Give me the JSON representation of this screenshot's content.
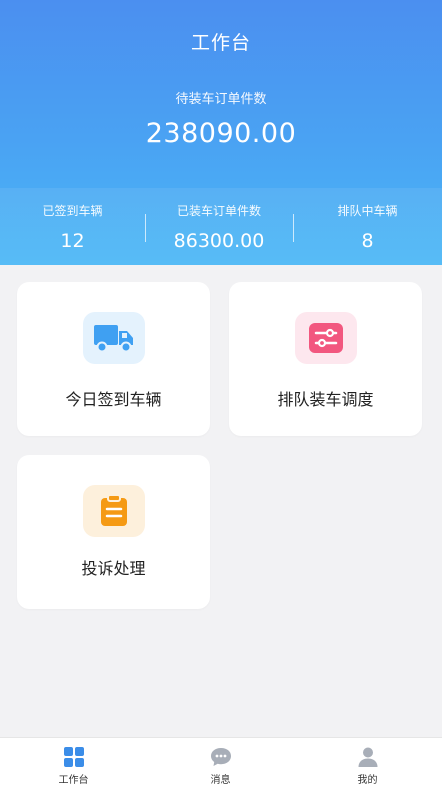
{
  "header": {
    "title": "工作台",
    "main_label": "待装车订单件数",
    "main_value": "238090.00"
  },
  "stats": [
    {
      "label": "已签到车辆",
      "value": "12"
    },
    {
      "label": "已装车订单件数",
      "value": "86300.00"
    },
    {
      "label": "排队中车辆",
      "value": "8"
    }
  ],
  "cards": [
    {
      "label": "今日签到车辆",
      "icon": "truck-icon",
      "color": "#3fa0f2"
    },
    {
      "label": "排队装车调度",
      "icon": "sliders-icon",
      "color": "#f2577f"
    },
    {
      "label": "投诉处理",
      "icon": "clipboard-icon",
      "color": "#f59a14"
    }
  ],
  "tabbar": [
    {
      "label": "工作台",
      "icon": "grid-icon",
      "active": true
    },
    {
      "label": "消息",
      "icon": "chat-bubble-icon",
      "active": false
    },
    {
      "label": "我的",
      "icon": "user-icon",
      "active": false
    }
  ],
  "colors": {
    "header_top": "#4b8ff0",
    "header_bottom": "#49b7f6",
    "tab_active": "#3b8de8",
    "tab_inactive": "#a8aeb8"
  }
}
